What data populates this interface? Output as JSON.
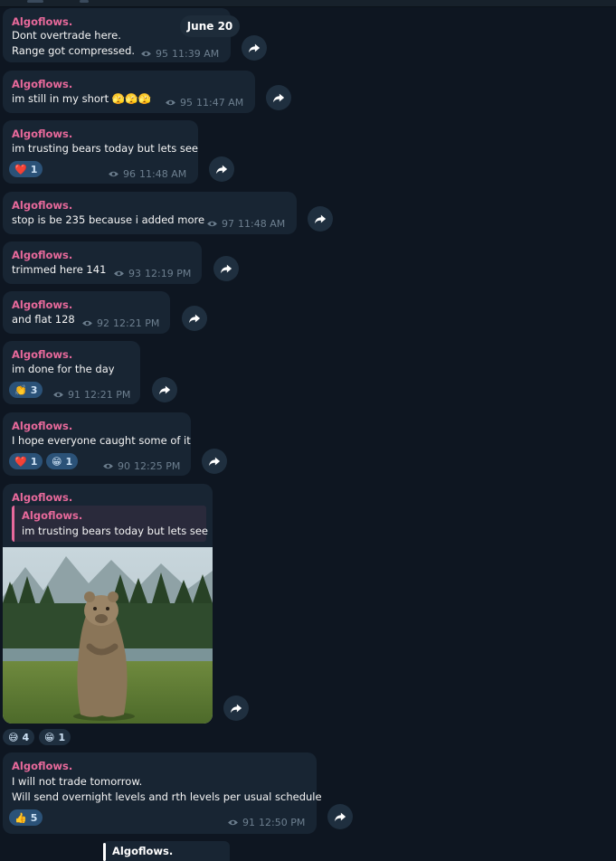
{
  "date_pill": "June 20",
  "colors": {
    "background": "#0e1621",
    "bubble": "#182533",
    "author": "#e8699b",
    "meta": "#6d7f8f",
    "reaction": "#2b5278"
  },
  "messages": [
    {
      "author": "Algoflows.",
      "lines": [
        "Dont overtrade here.",
        "Range got compressed."
      ],
      "views": "95",
      "time": "11:39 AM"
    },
    {
      "author": "Algoflows.",
      "lines": [
        "im still in my short 🫣🫣🫣"
      ],
      "views": "95",
      "time": "11:47 AM"
    },
    {
      "author": "Algoflows.",
      "lines": [
        "im trusting bears today but lets see"
      ],
      "views": "96",
      "time": "11:48 AM",
      "reactions": [
        {
          "emoji": "❤️",
          "count": "1"
        }
      ]
    },
    {
      "author": "Algoflows.",
      "lines": [
        "stop is be 235 because i added more"
      ],
      "views": "97",
      "time": "11:48 AM"
    },
    {
      "author": "Algoflows.",
      "lines": [
        "trimmed here 141"
      ],
      "views": "93",
      "time": "12:19 PM"
    },
    {
      "author": "Algoflows.",
      "lines": [
        "and flat 128"
      ],
      "views": "92",
      "time": "12:21 PM"
    },
    {
      "author": "Algoflows.",
      "lines": [
        "im done for the day"
      ],
      "views": "91",
      "time": "12:21 PM",
      "reactions": [
        {
          "emoji": "👏",
          "count": "3"
        }
      ]
    },
    {
      "author": "Algoflows.",
      "lines": [
        "I hope everyone caught some of it"
      ],
      "views": "90",
      "time": "12:25 PM",
      "reactions": [
        {
          "emoji": "❤️",
          "count": "1"
        },
        {
          "emoji": "😁",
          "count": "1"
        }
      ]
    },
    {
      "author": "Algoflows.",
      "reply_to": {
        "author": "Algoflows.",
        "text": "im trusting bears today but lets see"
      },
      "media": "bear-gif",
      "reactions": [
        {
          "emoji": "😅",
          "count": "4"
        },
        {
          "emoji": "😁",
          "count": "1"
        }
      ]
    },
    {
      "author": "Algoflows.",
      "lines": [
        "I will not trade tomorrow.",
        "Will send overnight levels and rth levels per usual schedule"
      ],
      "views": "91",
      "time": "12:50 PM",
      "reactions": [
        {
          "emoji": "👍",
          "count": "5"
        }
      ]
    }
  ],
  "partial_next": {
    "author": "Algoflows."
  },
  "icons": {
    "forward": "forward-arrow-icon",
    "views": "eye-icon"
  }
}
